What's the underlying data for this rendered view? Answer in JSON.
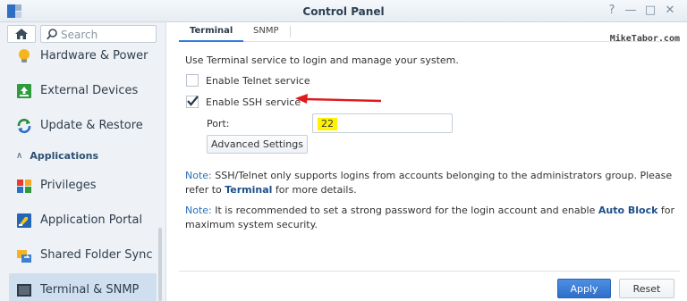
{
  "window": {
    "title": "Control Panel",
    "controls": [
      "?",
      "—",
      "□",
      "✕"
    ]
  },
  "sidebar": {
    "search_placeholder": "Search",
    "items": [
      {
        "label": "Hardware & Power",
        "icon": "bulb-icon"
      },
      {
        "label": "External Devices",
        "icon": "external-device-icon"
      },
      {
        "label": "Update & Restore",
        "icon": "update-icon"
      },
      {
        "label": "Privileges",
        "icon": "privileges-icon"
      },
      {
        "label": "Application Portal",
        "icon": "app-portal-icon"
      },
      {
        "label": "Shared Folder Sync",
        "icon": "folder-sync-icon"
      },
      {
        "label": "Terminal & SNMP",
        "icon": "terminal-icon",
        "active": true
      }
    ],
    "section_label": "Applications"
  },
  "tabs": [
    {
      "label": "Terminal",
      "active": true
    },
    {
      "label": "SNMP",
      "active": false
    }
  ],
  "watermark": "MikeTabor.com",
  "terminal": {
    "description": "Use Terminal service to login and manage your system.",
    "telnet_label": "Enable Telnet service",
    "telnet_checked": false,
    "ssh_label": "Enable SSH service",
    "ssh_checked": true,
    "port_label": "Port:",
    "port_value": "22",
    "advanced_button": "Advanced Settings"
  },
  "notes": {
    "note1_prefix": "Note:",
    "note1_text": " SSH/Telnet only supports logins from accounts belonging to the administrators group. Please refer to ",
    "note1_link": "Terminal",
    "note1_suffix": " for more details.",
    "note2_prefix": "Note:",
    "note2_text": " It is recommended to set a strong password for the login account and enable ",
    "note2_link": "Auto Block",
    "note2_suffix": " for maximum system security."
  },
  "footer": {
    "apply_label": "Apply",
    "reset_label": "Reset"
  },
  "colors": {
    "accent": "#2d7be0",
    "annotation_arrow": "#e0191b",
    "highlight": "#fff200"
  }
}
